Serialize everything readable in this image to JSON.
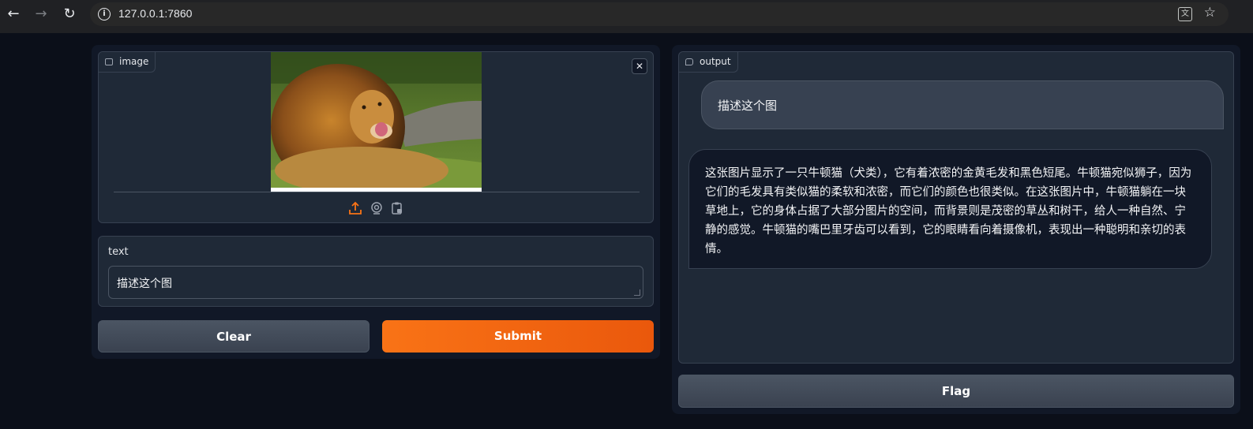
{
  "browser": {
    "url": "127.0.0.1:7860",
    "back_icon": "arrow-left-icon",
    "forward_icon": "arrow-right-icon",
    "reload_icon": "reload-icon"
  },
  "left": {
    "image_label": "image",
    "text_label": "text",
    "text_value": "描述这个图",
    "clear_label": "Clear",
    "submit_label": "Submit"
  },
  "right": {
    "output_label": "output",
    "user_message": "描述这个图",
    "bot_message": "这张图片显示了一只牛顿猫（犬类），它有着浓密的金黄毛发和黑色短尾。牛顿猫宛似狮子，因为它们的毛发具有类似猫的柔软和浓密，而它们的颜色也很类似。在这张图片中，牛顿猫躺在一块草地上，它的身体占据了大部分图片的空间，而背景则是茂密的草丛和树干，给人一种自然、宁静的感觉。牛顿猫的嘴巴里牙齿可以看到，它的眼睛看向着摄像机，表现出一种聪明和亲切的表情。",
    "flag_label": "Flag"
  },
  "colors": {
    "accent": "#f97316",
    "background": "#0b0f19",
    "panel": "#1f2937"
  }
}
